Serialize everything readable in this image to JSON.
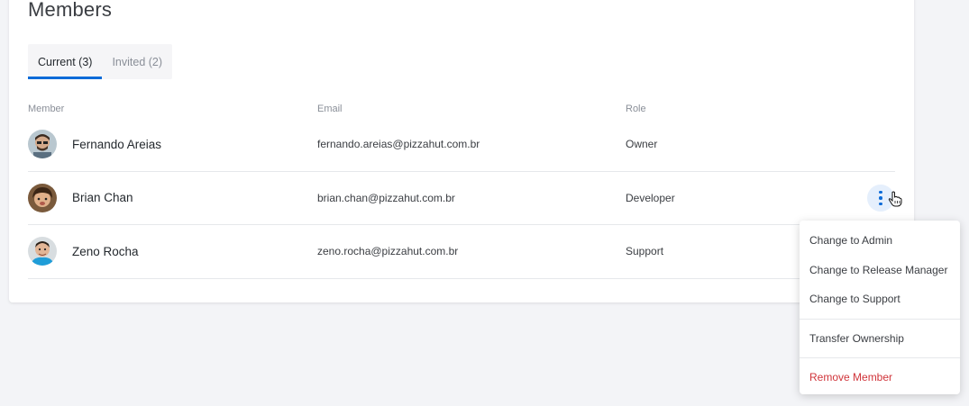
{
  "page": {
    "title": "Members"
  },
  "tabs": [
    {
      "label": "Current (3)",
      "active": true
    },
    {
      "label": "Invited (2)",
      "active": false
    }
  ],
  "table": {
    "headers": {
      "member": "Member",
      "email": "Email",
      "role": "Role"
    },
    "rows": [
      {
        "name": "Fernando Areias",
        "email": "fernando.areias@pizzahut.com.br",
        "role": "Owner",
        "avatar_bg": "#8a6f58"
      },
      {
        "name": "Brian Chan",
        "email": "brian.chan@pizzahut.com.br",
        "role": "Developer",
        "avatar_bg": "#4b3a2c"
      },
      {
        "name": "Zeno Rocha",
        "email": "zeno.rocha@pizzahut.com.br",
        "role": "Support",
        "avatar_bg": "#2fa6d9"
      }
    ]
  },
  "row_menu": {
    "items": [
      {
        "label": "Change to Admin"
      },
      {
        "label": "Change to Release Manager"
      },
      {
        "label": "Change to Support"
      },
      {
        "label": "Transfer Ownership"
      },
      {
        "label": "Remove Member"
      }
    ]
  },
  "colors": {
    "accent": "#0b6bd8",
    "danger": "#d0343a",
    "background": "#f3f4f7"
  }
}
